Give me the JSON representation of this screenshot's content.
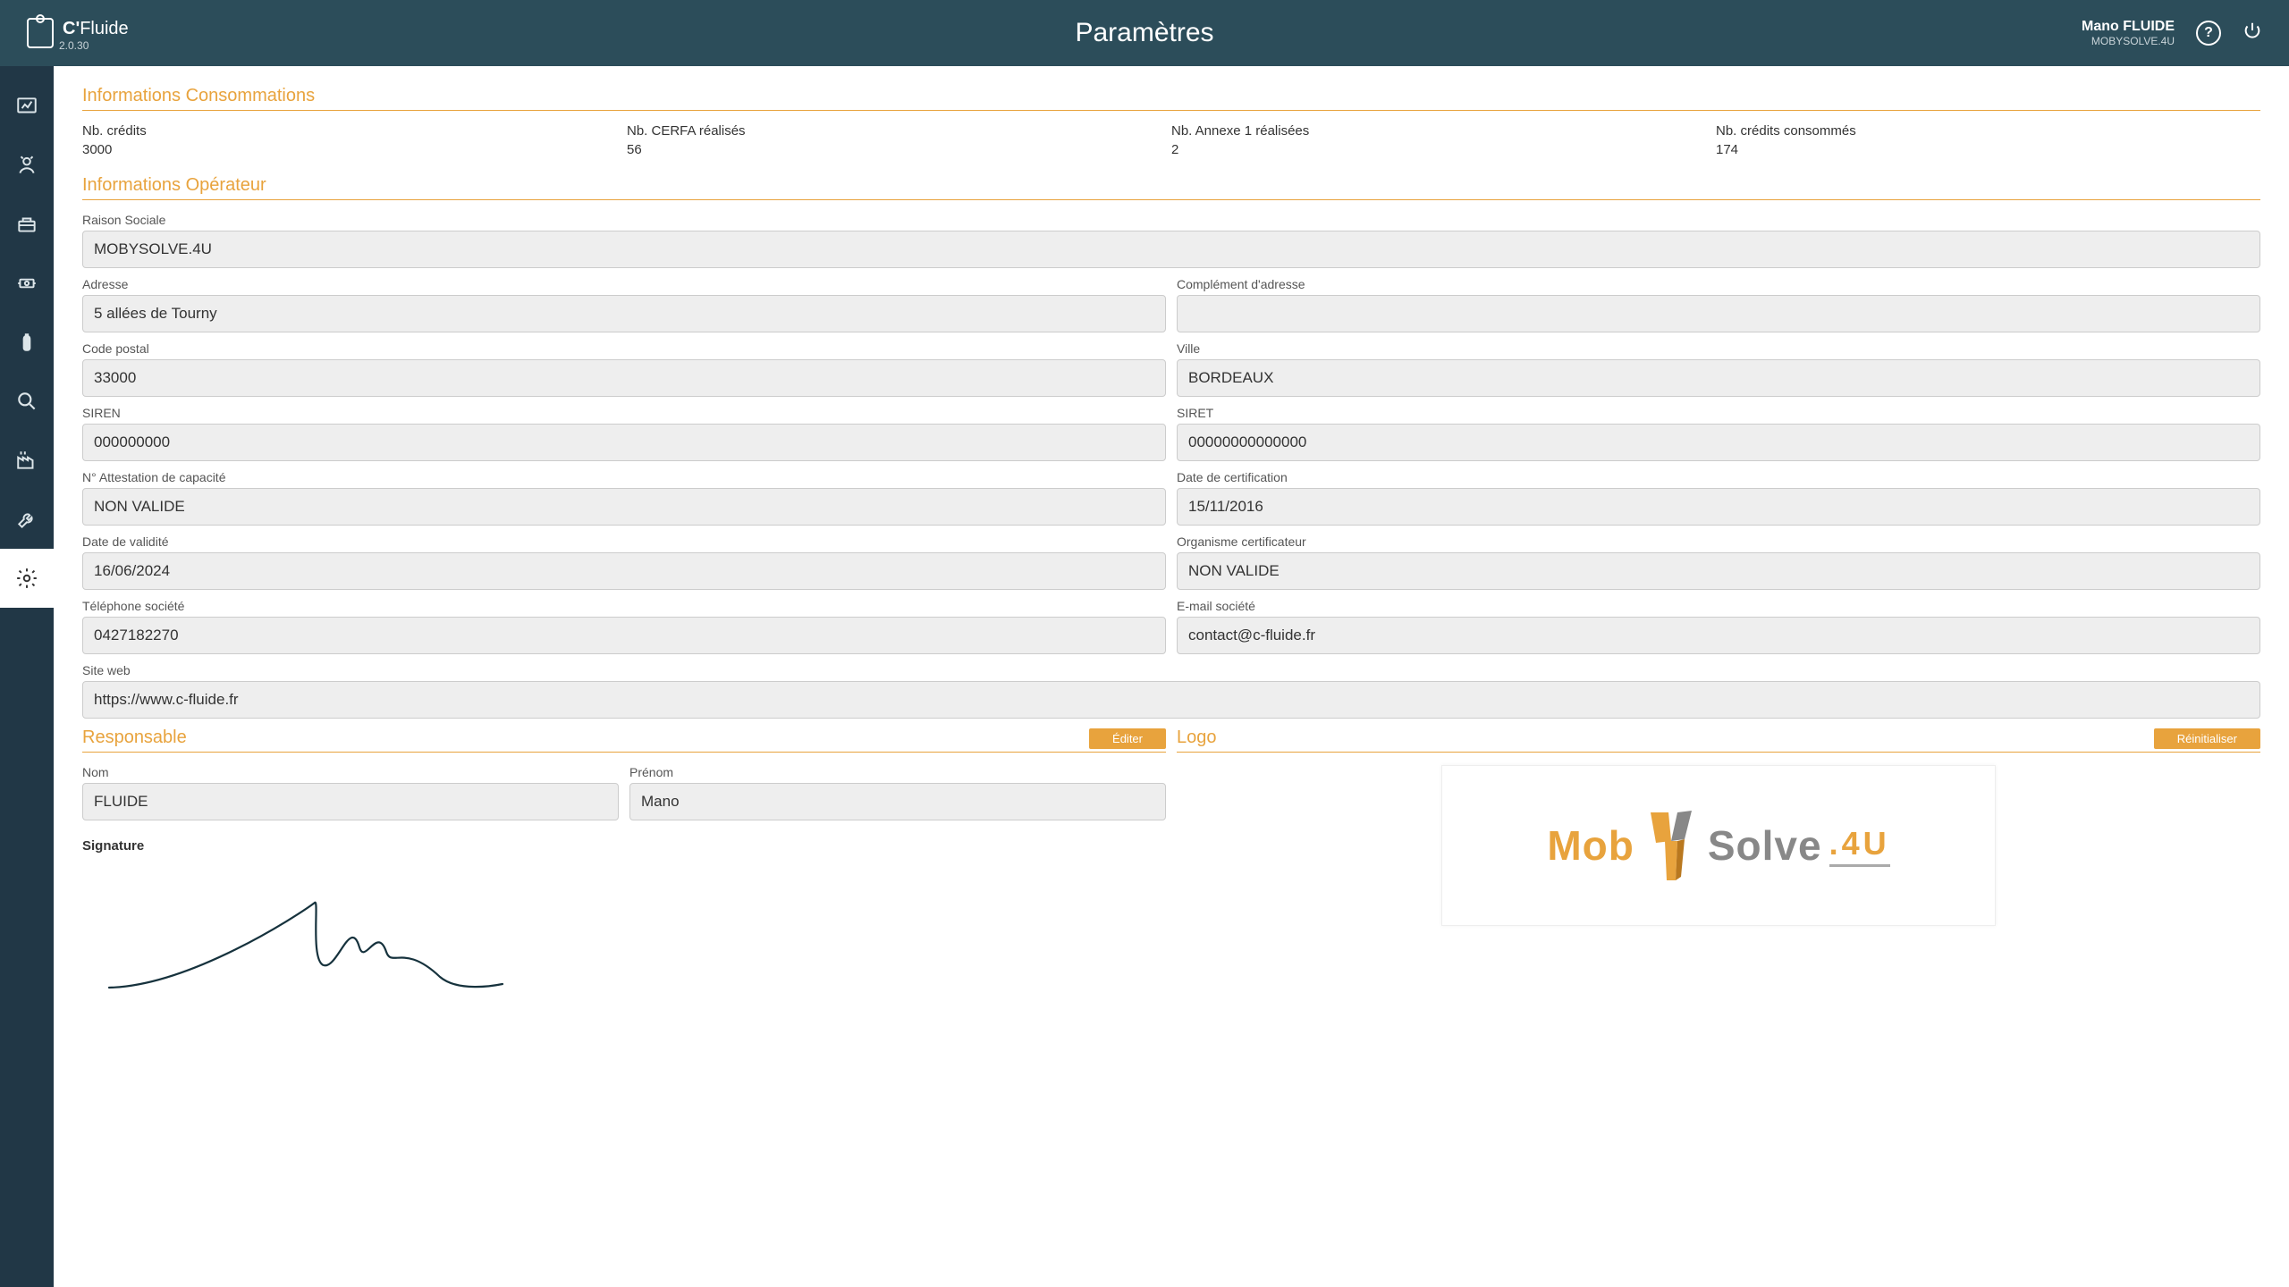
{
  "header": {
    "app_name_prefix": "C'",
    "app_name": "Fluide",
    "version": "2.0.30",
    "title": "Paramètres",
    "user_name": "Mano FLUIDE",
    "user_org": "MOBYSOLVE.4U"
  },
  "sections": {
    "consommations_title": "Informations Consommations",
    "operateur_title": "Informations Opérateur",
    "responsable_title": "Responsable",
    "logo_title": "Logo",
    "edit_button": "Éditer",
    "reset_button": "Réinitialiser"
  },
  "stats": {
    "credits_label": "Nb. crédits",
    "credits_value": "3000",
    "cerfa_label": "Nb. CERFA réalisés",
    "cerfa_value": "56",
    "annexe_label": "Nb. Annexe 1 réalisées",
    "annexe_value": "2",
    "consommes_label": "Nb. crédits consommés",
    "consommes_value": "174"
  },
  "operateur": {
    "raison_sociale_label": "Raison Sociale",
    "raison_sociale": "MOBYSOLVE.4U",
    "adresse_label": "Adresse",
    "adresse": "5 allées de Tourny",
    "complement_label": "Complément d'adresse",
    "complement": "",
    "cp_label": "Code postal",
    "cp": "33000",
    "ville_label": "Ville",
    "ville": "BORDEAUX",
    "siren_label": "SIREN",
    "siren": "000000000",
    "siret_label": "SIRET",
    "siret": "00000000000000",
    "attestation_label": "N° Attestation de capacité",
    "attestation": "NON VALIDE",
    "date_cert_label": "Date de certification",
    "date_cert": "15/11/2016",
    "date_validite_label": "Date de validité",
    "date_validite": "16/06/2024",
    "organisme_label": "Organisme certificateur",
    "organisme": "NON VALIDE",
    "tel_label": "Téléphone société",
    "tel": "0427182270",
    "email_label": "E-mail société",
    "email": "contact@c-fluide.fr",
    "web_label": "Site web",
    "web": "https://www.c-fluide.fr"
  },
  "responsable": {
    "nom_label": "Nom",
    "nom": "FLUIDE",
    "prenom_label": "Prénom",
    "prenom": "Mano",
    "signature_label": "Signature"
  },
  "logo_brand": {
    "mob": "Mob",
    "solve": "Solve",
    "suffix": ".4U"
  }
}
